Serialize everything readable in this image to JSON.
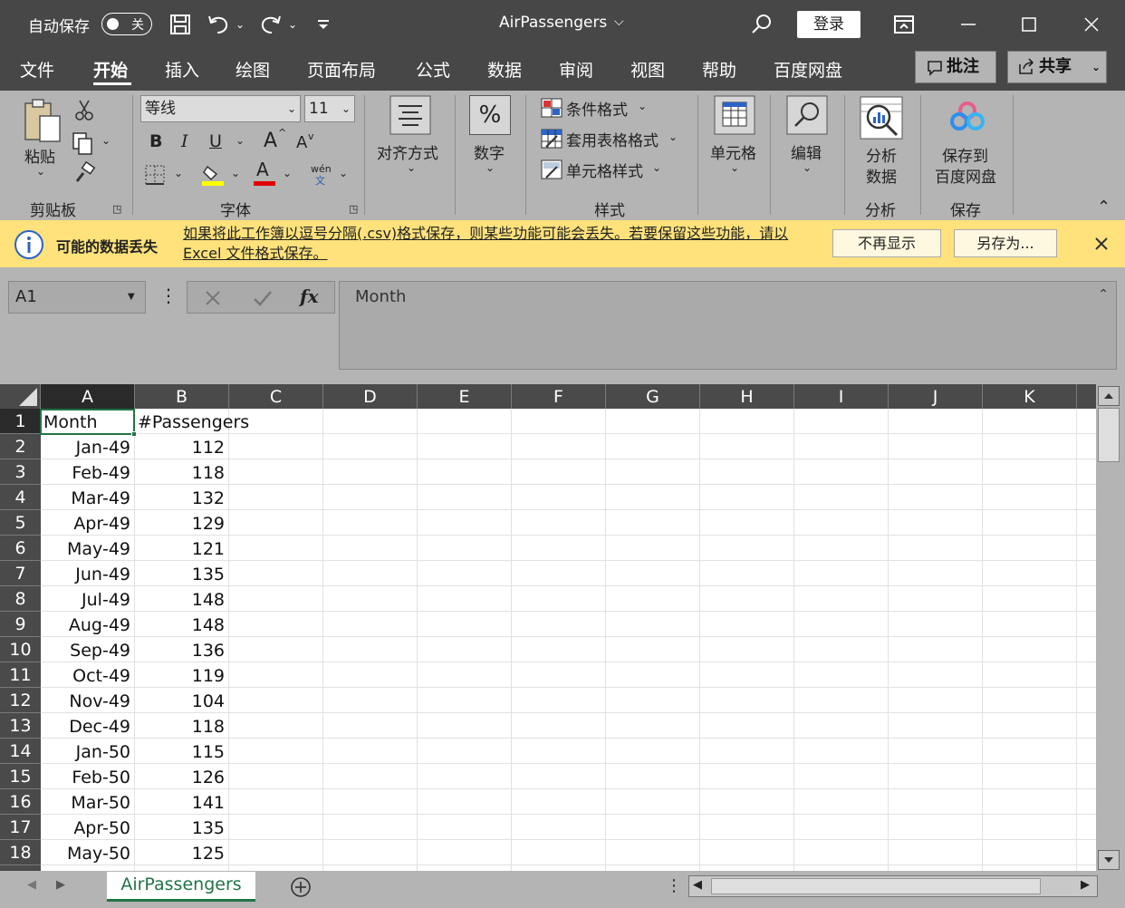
{
  "titlebar": {
    "autosave_label": "自动保存",
    "autosave_state": "关",
    "doc_title": "AirPassengers",
    "login_label": "登录"
  },
  "tabs": [
    "文件",
    "开始",
    "插入",
    "绘图",
    "页面布局",
    "公式",
    "数据",
    "审阅",
    "视图",
    "帮助",
    "百度网盘"
  ],
  "active_tab": "开始",
  "top_buttons": {
    "comments": "批注",
    "share": "共享"
  },
  "ribbon": {
    "clipboard": {
      "paste": "粘贴",
      "group": "剪贴板"
    },
    "font": {
      "name": "等线",
      "size": "11",
      "bold": "B",
      "italic": "I",
      "underline": "U",
      "grow": "A",
      "shrink": "A",
      "phonetic_top": "wén",
      "phonetic_bottom": "文",
      "color_letter": "A",
      "group": "字体"
    },
    "alignment": {
      "label": "对齐方式"
    },
    "number": {
      "label": "数字",
      "symbol": "%"
    },
    "styles": {
      "conditional": "条件格式",
      "table": "套用表格格式",
      "cell": "单元格样式",
      "group": "样式"
    },
    "cells": {
      "label": "单元格"
    },
    "editing": {
      "label": "编辑"
    },
    "analysis": {
      "label_line1": "分析",
      "label_line2": "数据",
      "group": "分析"
    },
    "save": {
      "label_line1": "保存到",
      "label_line2": "百度网盘",
      "group": "保存"
    }
  },
  "infobar": {
    "title": "可能的数据丢失",
    "message": "如果将此工作簿以逗号分隔(.csv)格式保存，则某些功能可能会丢失。若要保留这些功能，请以 Excel 文件格式保存。",
    "dismiss": "不再显示",
    "save_as": "另存为..."
  },
  "formula_bar": {
    "name_box": "A1",
    "fx": "fx",
    "content": "Month"
  },
  "columns": [
    "A",
    "B",
    "C",
    "D",
    "E",
    "F",
    "G",
    "H",
    "I",
    "J",
    "K"
  ],
  "rows": [
    [
      "Month",
      "#Passengers"
    ],
    [
      "Jan-49",
      "112"
    ],
    [
      "Feb-49",
      "118"
    ],
    [
      "Mar-49",
      "132"
    ],
    [
      "Apr-49",
      "129"
    ],
    [
      "May-49",
      "121"
    ],
    [
      "Jun-49",
      "135"
    ],
    [
      "Jul-49",
      "148"
    ],
    [
      "Aug-49",
      "148"
    ],
    [
      "Sep-49",
      "136"
    ],
    [
      "Oct-49",
      "119"
    ],
    [
      "Nov-49",
      "104"
    ],
    [
      "Dec-49",
      "118"
    ],
    [
      "Jan-50",
      "115"
    ],
    [
      "Feb-50",
      "126"
    ],
    [
      "Mar-50",
      "141"
    ],
    [
      "Apr-50",
      "135"
    ],
    [
      "May-50",
      "125"
    ]
  ],
  "sheet_tab": "AirPassengers",
  "colors": {
    "accent": "#217346",
    "titlebar": "#474747",
    "infobar": "#ffe27b"
  }
}
